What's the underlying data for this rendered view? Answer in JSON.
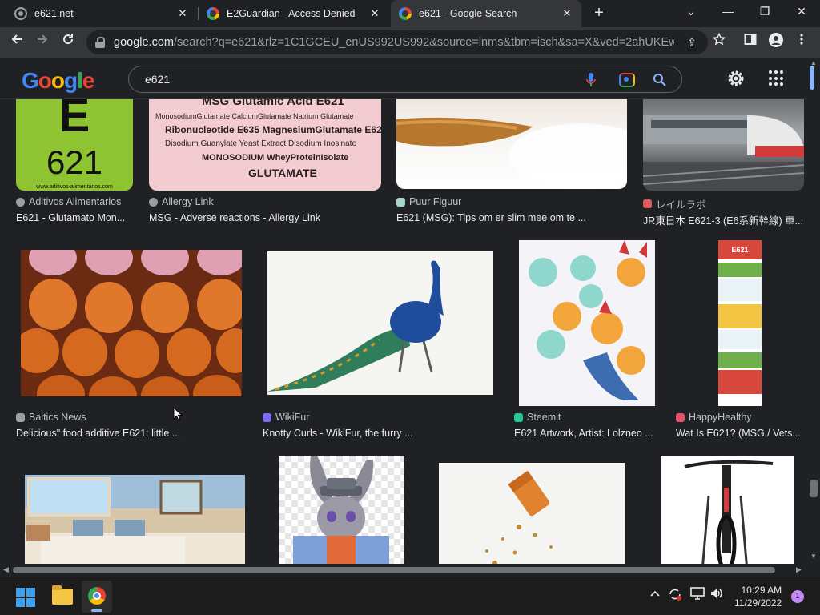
{
  "browser": {
    "tabs": [
      {
        "title": "e621.net",
        "active": false,
        "favicon": "globe-icon"
      },
      {
        "title": "E2Guardian - Access Denied",
        "active": false,
        "favicon": "google-icon"
      },
      {
        "title": "e621 - Google Search",
        "active": true,
        "favicon": "google-icon"
      }
    ],
    "new_tab_glyph": "+",
    "window_controls": {
      "dropdown": "⌄",
      "minimize": "—",
      "restore": "❐",
      "close": "✕"
    },
    "address": {
      "host": "google.com",
      "path": "/search?q=e621&rlz=1C1GCEU_enUS992US992&source=lnms&tbm=isch&sa=X&ved=2ahUKEwjIhZ..."
    }
  },
  "google": {
    "logo": "Google",
    "query": "e621"
  },
  "results": [
    {
      "source": "Aditivos Alimentarios",
      "title": "E621 - Glutamato Mon...",
      "source_icon_color": "#9aa0a6"
    },
    {
      "source": "Allergy Link",
      "title": "MSG - Adverse reactions - Allergy Link",
      "source_icon_color": "#9aa0a6"
    },
    {
      "source": "Puur Figuur",
      "title": "E621 (MSG): Tips om er slim mee om te ...",
      "source_icon_color": "#a8d8c8"
    },
    {
      "source": "レイルラボ",
      "title": "JR東日本 E621-3 (E6系新幹線) 車...",
      "source_icon_color": "#e25b5b"
    },
    {
      "source": "Baltics News",
      "title": "Delicious\" food additive E621: little ...",
      "source_icon_color": "#9aa0a6"
    },
    {
      "source": "WikiFur",
      "title": "Knotty Curls - WikiFur, the furry ...",
      "source_icon_color": "#7b6cf6"
    },
    {
      "source": "Steemit",
      "title": "E621 Artwork, Artist: Lolzneo ...",
      "source_icon_color": "#20c997"
    },
    {
      "source": "HappyHealthy",
      "title": "Wat Is E621? (MSG / Vets...",
      "source_icon_color": "#e8506a"
    }
  ],
  "thumb_text": {
    "e621_letter": "E",
    "e621_number": "621",
    "e621_site": "www.aditivos-alimentarios.com",
    "msg_lines": [
      "MSG Glutamic Acid E621",
      "MonosodiumGlutamate CalciumGlutamate Natrium Glutamate",
      "Ribonucleotide E635 MagnesiumGlutamate E627",
      "Disodium Guanylate Yeast Extract Disodium Inosinate",
      "MONOSODIUM WheyProteinIsolate",
      "GLUTAMATE"
    ],
    "info_badge": "E621"
  },
  "taskbar": {
    "time": "10:29 AM",
    "date": "11/29/2022",
    "notifications": "1"
  },
  "colors": {
    "page_bg": "#202124",
    "toolbar_bg": "#35363a",
    "accent_blue": "#8ab4f8",
    "text_primary": "#e8eaed",
    "text_secondary": "#bdc1c6"
  }
}
